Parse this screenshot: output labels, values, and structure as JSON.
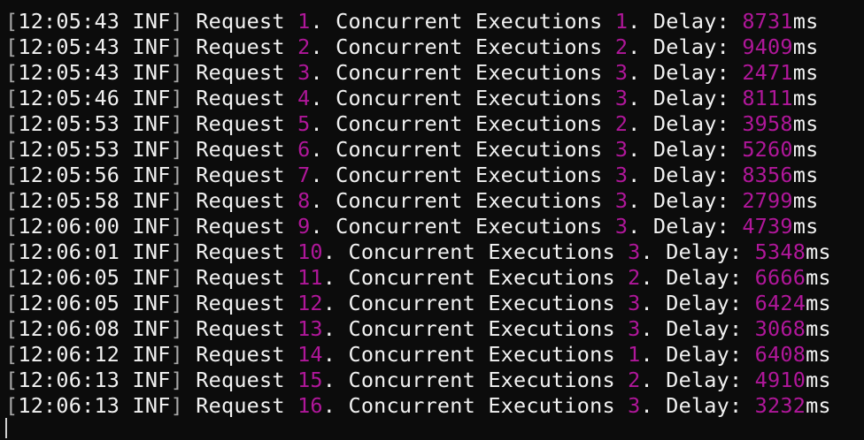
{
  "colors": {
    "background": "#0c0c0c",
    "text": "#f2f2f2",
    "bracket": "#a8a8a8",
    "number": "#b0179a"
  },
  "labels": {
    "level": "INF",
    "request": "Request",
    "concurrent": "Concurrent Executions",
    "delay": "Delay:",
    "unit": "ms"
  },
  "lines": [
    {
      "time": "12:05:43",
      "req": "1",
      "conc": "1",
      "delay": "8731"
    },
    {
      "time": "12:05:43",
      "req": "2",
      "conc": "2",
      "delay": "9409"
    },
    {
      "time": "12:05:43",
      "req": "3",
      "conc": "3",
      "delay": "2471"
    },
    {
      "time": "12:05:46",
      "req": "4",
      "conc": "3",
      "delay": "8111"
    },
    {
      "time": "12:05:53",
      "req": "5",
      "conc": "2",
      "delay": "3958"
    },
    {
      "time": "12:05:53",
      "req": "6",
      "conc": "3",
      "delay": "5260"
    },
    {
      "time": "12:05:56",
      "req": "7",
      "conc": "3",
      "delay": "8356"
    },
    {
      "time": "12:05:58",
      "req": "8",
      "conc": "3",
      "delay": "2799"
    },
    {
      "time": "12:06:00",
      "req": "9",
      "conc": "3",
      "delay": "4739"
    },
    {
      "time": "12:06:01",
      "req": "10",
      "conc": "3",
      "delay": "5348"
    },
    {
      "time": "12:06:05",
      "req": "11",
      "conc": "2",
      "delay": "6666"
    },
    {
      "time": "12:06:05",
      "req": "12",
      "conc": "3",
      "delay": "6424"
    },
    {
      "time": "12:06:08",
      "req": "13",
      "conc": "3",
      "delay": "3068"
    },
    {
      "time": "12:06:12",
      "req": "14",
      "conc": "1",
      "delay": "6408"
    },
    {
      "time": "12:06:13",
      "req": "15",
      "conc": "2",
      "delay": "4910"
    },
    {
      "time": "12:06:13",
      "req": "16",
      "conc": "3",
      "delay": "3232"
    }
  ]
}
